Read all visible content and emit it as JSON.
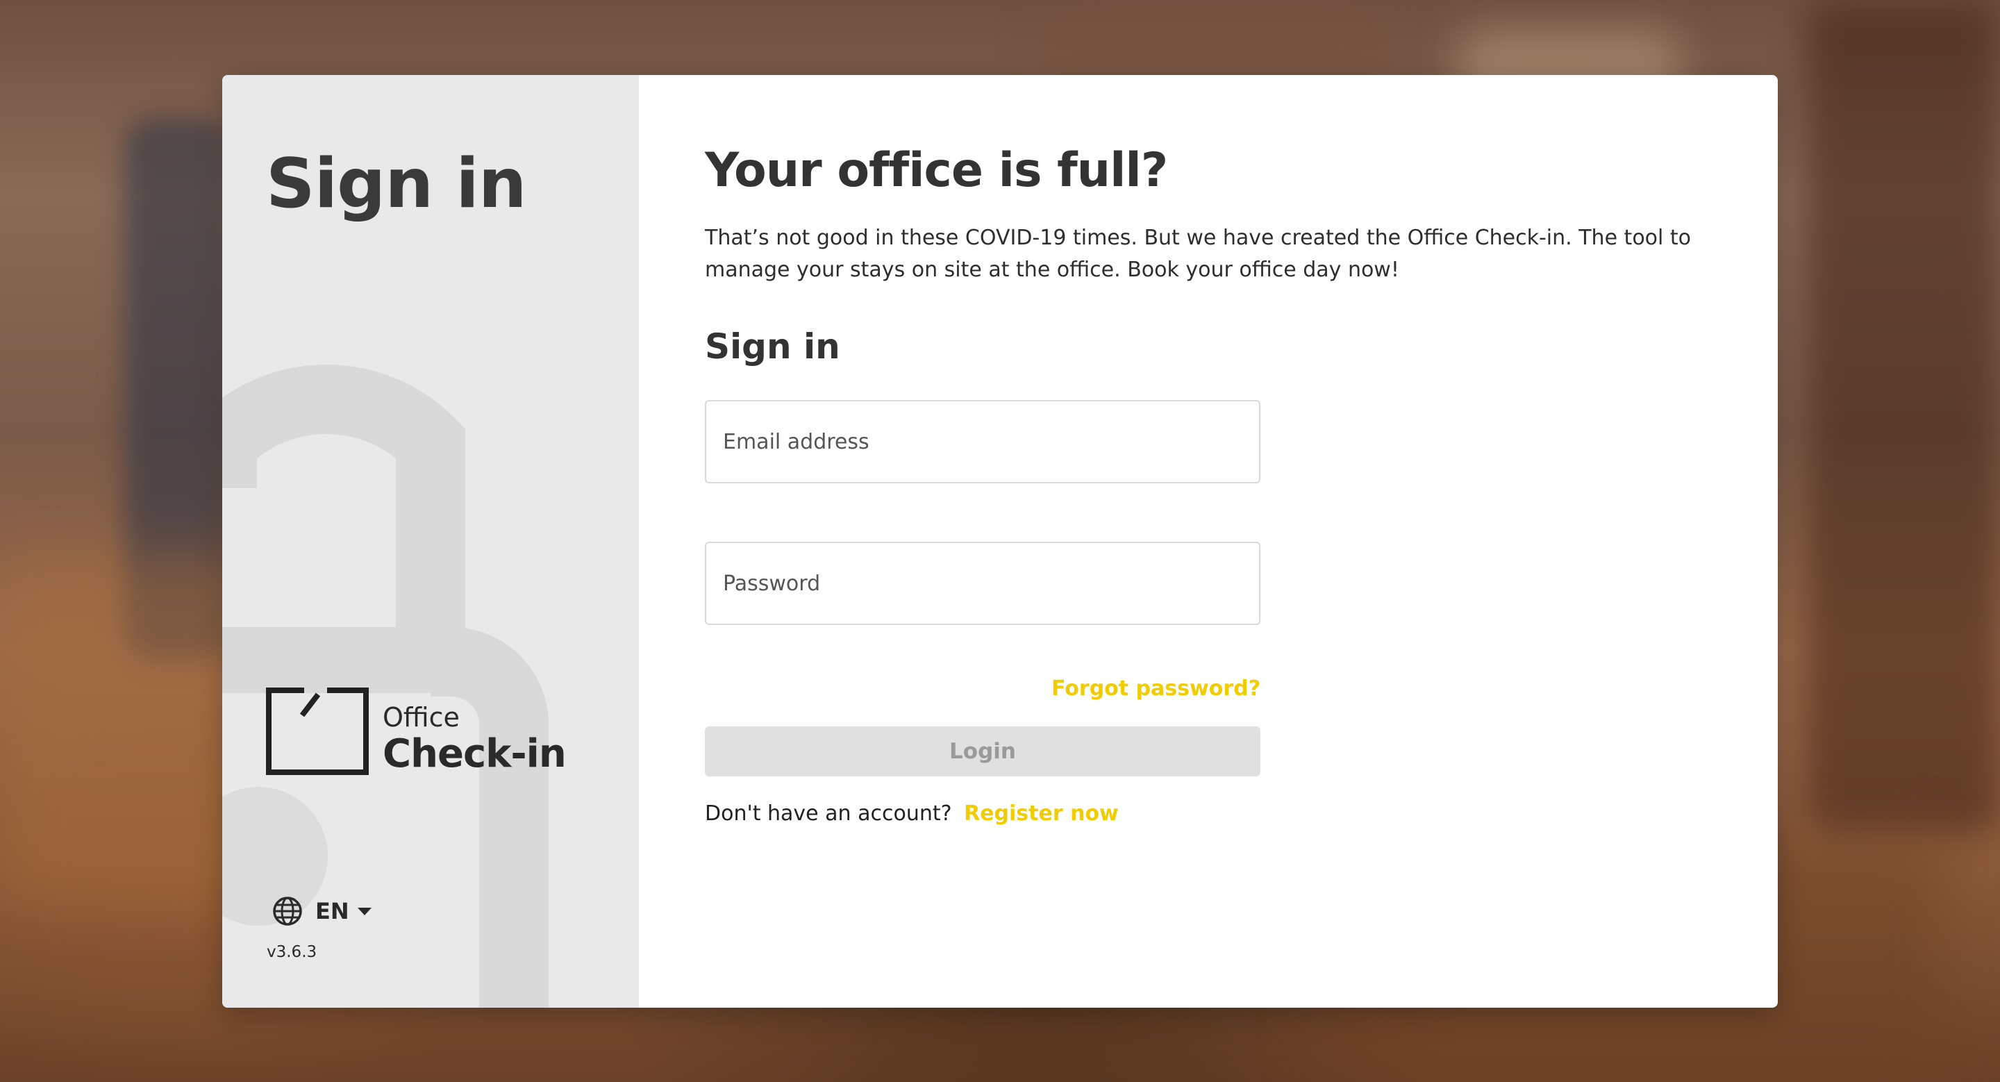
{
  "brand": {
    "left_title": "Sign in",
    "logo_line1": "Office",
    "logo_line2": "Check-in",
    "version": "v3.6.3"
  },
  "language": {
    "icon": "globe-icon",
    "selected": "EN",
    "caret_icon": "caret-down-icon"
  },
  "main": {
    "headline": "Your office is full?",
    "intro": "That’s not good in these COVID-19 times. But we have created the Office Check-in. The tool to manage your stays on site at the office. Book your office day now!",
    "form_title": "Sign in",
    "email_placeholder": "Email address",
    "password_placeholder": "Password",
    "forgot_password": "Forgot password?",
    "login_label": "Login",
    "no_account_text": "Don't have an account?",
    "register_label": "Register now"
  },
  "colors": {
    "accent": "#f0cc00",
    "left_panel": "#e9e9e9",
    "login_disabled_bg": "#e0e0e0",
    "heading": "#333333"
  }
}
